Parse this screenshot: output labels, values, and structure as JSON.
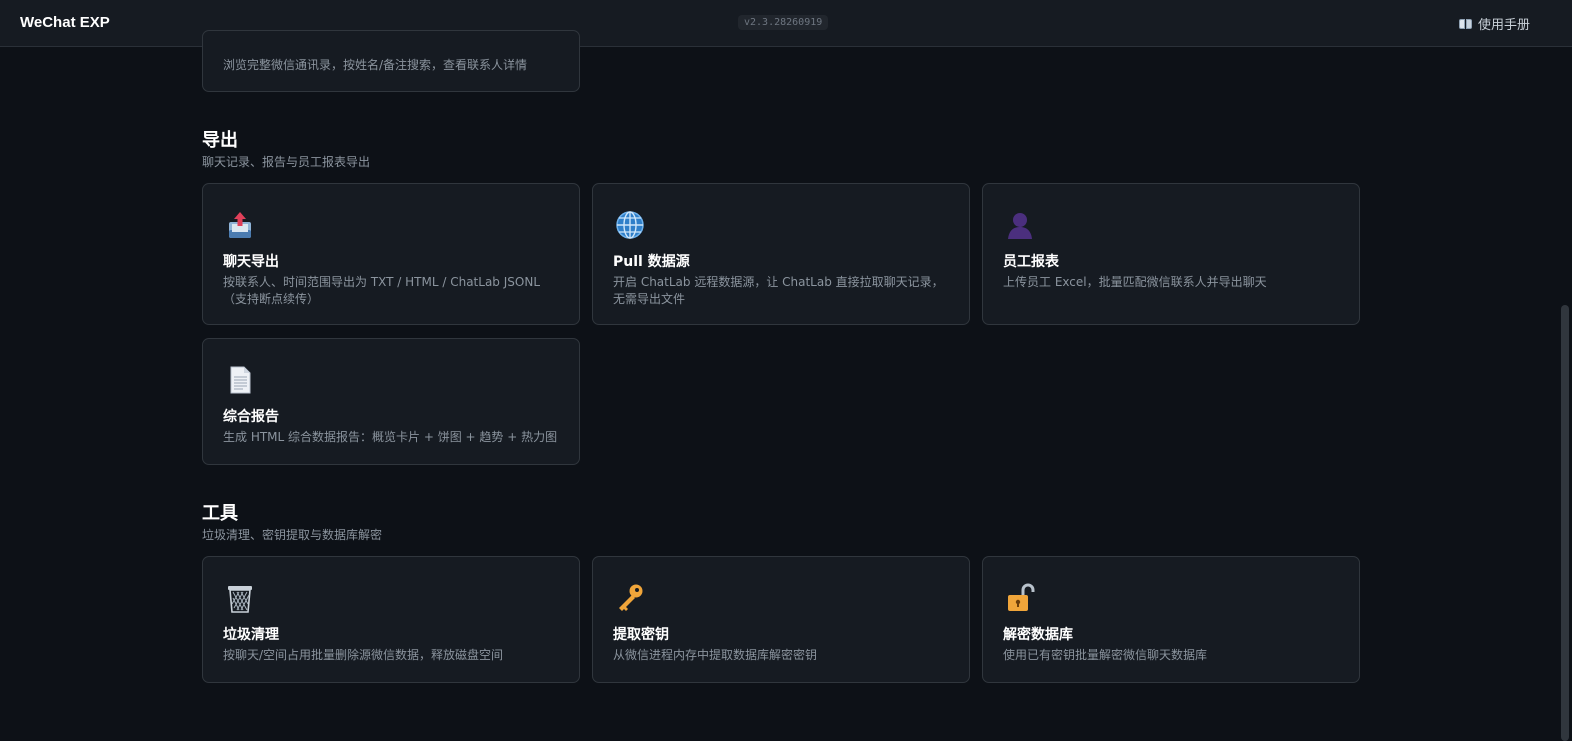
{
  "header": {
    "brand": "WeChat EXP",
    "version": "v2.3.28260919",
    "manual_label": "使用手册"
  },
  "contacts_card": {
    "desc": "浏览完整微信通讯录，按姓名/备注搜索，查看联系人详情"
  },
  "sections": {
    "export": {
      "title": "导出",
      "subtitle": "聊天记录、报告与员工报表导出",
      "cards": [
        {
          "title": "聊天导出",
          "desc": "按联系人、时间范围导出为 TXT / HTML / ChatLab JSONL（支持断点续传）",
          "icon": "outbox-tray-icon"
        },
        {
          "title": "Pull 数据源",
          "desc": "开启 ChatLab 远程数据源，让 ChatLab 直接拉取聊天记录，无需导出文件",
          "icon": "globe-icon"
        },
        {
          "title": "员工报表",
          "desc": "上传员工 Excel，批量匹配微信联系人并导出聊天",
          "icon": "person-silhouette-icon"
        },
        {
          "title": "综合报告",
          "desc": "生成 HTML 综合数据报告：概览卡片 + 饼图 + 趋势 + 热力图",
          "icon": "document-icon"
        }
      ]
    },
    "tools": {
      "title": "工具",
      "subtitle": "垃圾清理、密钥提取与数据库解密",
      "cards": [
        {
          "title": "垃圾清理",
          "desc": "按聊天/空间占用批量删除源微信数据，释放磁盘空间",
          "icon": "wastebasket-icon"
        },
        {
          "title": "提取密钥",
          "desc": "从微信进程内存中提取数据库解密密钥",
          "icon": "key-icon"
        },
        {
          "title": "解密数据库",
          "desc": "使用已有密钥批量解密微信聊天数据库",
          "icon": "open-lock-icon"
        }
      ]
    }
  },
  "colors": {
    "background": "#0d1117",
    "card_background": "#161b22",
    "card_border": "#30363d",
    "title_text": "#ffffff",
    "muted_text": "#8b949e"
  }
}
